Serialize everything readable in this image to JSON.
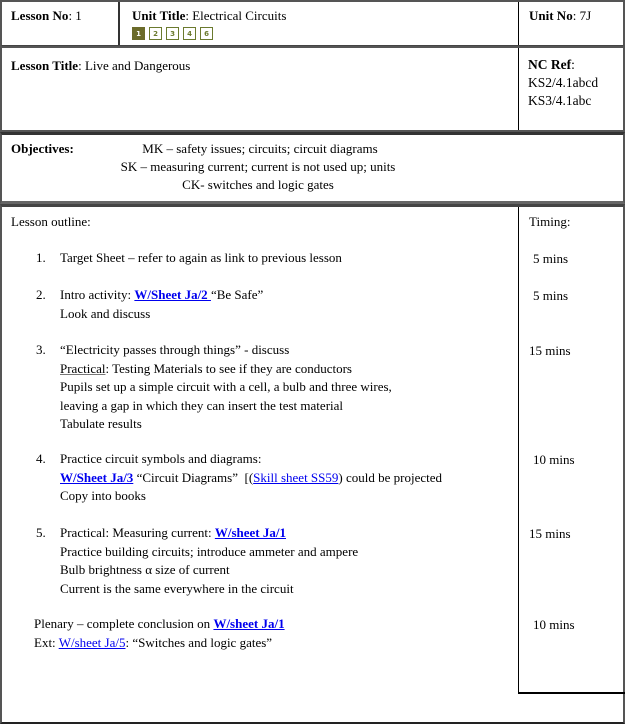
{
  "header": {
    "lesson_no_label": "Lesson No",
    "lesson_no_value": ": 1",
    "unit_title_label": "Unit Title",
    "unit_title_value": ": Electrical Circuits",
    "unit_no_label": "Unit No",
    "unit_no_value": ": 7J",
    "pager": {
      "active": "1",
      "pages": [
        "1",
        "2",
        "3",
        "4",
        "6"
      ],
      "accent_color": "#6b6b2a"
    }
  },
  "lesson": {
    "title_label": "Lesson Title",
    "title_value": ": Live and Dangerous",
    "nc_ref_label": "NC Ref",
    "nc_ref_colon": ":",
    "nc_refs": [
      "KS2/4.1abcd",
      "KS3/4.1abc"
    ]
  },
  "objectives": {
    "label": "Objectives:",
    "lines": [
      "MK – safety issues; circuits; circuit diagrams",
      "SK – measuring current; current is not used up; units",
      "CK- switches and logic gates"
    ]
  },
  "outline": {
    "label": "Lesson outline:",
    "timing_label": "Timing:",
    "items": [
      {
        "num": "1.",
        "lines": [
          "Target Sheet – refer to again as link to previous lesson"
        ],
        "timing": "5 mins"
      },
      {
        "num": "2.",
        "pre": "Intro activity: ",
        "link": "W/Sheet Ja/2 ",
        "post": "“Be Safe”",
        "lines": [
          "Look and discuss"
        ],
        "timing": "5 mins"
      },
      {
        "num": "3.",
        "first": "“Electricity passes through things” - discuss",
        "practical_label": "Practical",
        "practical_text": ": Testing Materials to see if they are conductors",
        "lines": [
          "Pupils set up a simple circuit with a cell, a bulb and three wires,",
          "leaving a gap in which they can insert the test material",
          "Tabulate results"
        ],
        "timing": "15 mins"
      },
      {
        "num": "4.",
        "first": "Practice circuit symbols and diagrams:",
        "link": "W/Sheet Ja/3",
        "mid": " “Circuit Diagrams”  [(",
        "link2": "Skill sheet SS59",
        "post": ") could be projected",
        "lines": [
          "Copy into books"
        ],
        "timing": "10 mins"
      },
      {
        "num": "5.",
        "pre": "Practical: Measuring current: ",
        "link": "W/sheet Ja/1",
        "lines": [
          "Practice building circuits; introduce ammeter and ampere",
          "Bulb brightness α size of current",
          "Current is the same everywhere in the circuit"
        ],
        "timing": "15 mins"
      }
    ],
    "plenary": {
      "pre": "Plenary – complete conclusion on ",
      "link": "W/sheet Ja/1",
      "timing": "10 mins"
    },
    "ext": {
      "pre": "Ext: ",
      "link": "W/sheet Ja/5",
      "post": ": “Switches and logic gates”"
    },
    "link_color": "#0000ee"
  }
}
